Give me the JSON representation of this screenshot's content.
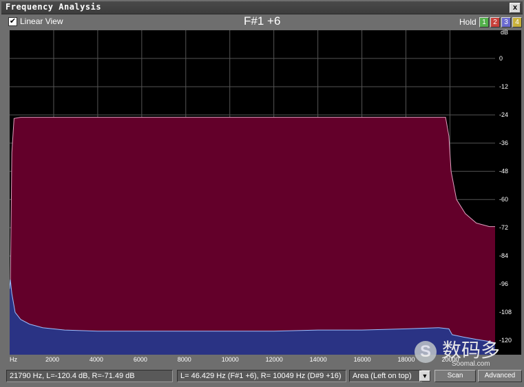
{
  "window": {
    "title": "Frequency Analysis",
    "close_glyph": "x"
  },
  "toolbar": {
    "linear_view_label": "Linear View",
    "linear_view_checked": true,
    "note_display": "F#1 +6",
    "hold_label": "Hold",
    "hold_buttons": [
      {
        "label": "1",
        "color": "#52b04a"
      },
      {
        "label": "2",
        "color": "#c8403a"
      },
      {
        "label": "3",
        "color": "#6a6ad0"
      },
      {
        "label": "4",
        "color": "#c8b03a"
      }
    ]
  },
  "chart_data": {
    "type": "area",
    "x_unit": "Hz",
    "y_unit": "dB",
    "xlim": [
      0,
      22050
    ],
    "ylim": [
      -126,
      12
    ],
    "x_ticks": [
      "Hz",
      "2000",
      "4000",
      "6000",
      "8000",
      "10000",
      "12000",
      "14000",
      "16000",
      "18000",
      "20000"
    ],
    "y_ticks": [
      "0",
      "-12",
      "-24",
      "-36",
      "-48",
      "-60",
      "-72",
      "-84",
      "-96",
      "-108",
      "-120"
    ],
    "grid": true,
    "series": [
      {
        "channel": "Right",
        "fill": "#63002a",
        "stroke": "#e0a0c0",
        "x": [
          0,
          100,
          200,
          500,
          1000,
          5000,
          10000,
          15000,
          19500,
          19800,
          19950,
          20050,
          20300,
          20700,
          21200,
          21790,
          22050
        ],
        "y": [
          -126,
          -40,
          -25.5,
          -25,
          -25,
          -25,
          -25,
          -25,
          -25,
          -25,
          -33,
          -48,
          -60,
          -66,
          -70,
          -71.5,
          -71.5
        ]
      },
      {
        "channel": "Left",
        "fill": "#2a3384",
        "stroke": "#9cc0ff",
        "x": [
          0,
          30,
          100,
          250,
          500,
          900,
          1500,
          2500,
          4000,
          6000,
          8000,
          10000,
          12000,
          14000,
          16000,
          18000,
          19500,
          19950,
          20100,
          20600,
          21200,
          21790,
          22050
        ],
        "y": [
          -98,
          -94,
          -100,
          -108,
          -111,
          -113,
          -114.5,
          -115.5,
          -116,
          -116,
          -116,
          -116,
          -116,
          -115.5,
          -115.5,
          -115,
          -114.5,
          -115,
          -117.5,
          -118.5,
          -119.5,
          -120.4,
          -121
        ]
      }
    ]
  },
  "status": {
    "cursor_readout": "21790 Hz, L=-120.4 dB, R=-71.49 dB",
    "peak_readout": "L= 46.429 Hz (F#1 +6), R=  10049 Hz (D#9 +16)",
    "view_mode": "Area (Left on top)",
    "dropdown_arrow_glyph": "▼",
    "scan_label": "Scan",
    "advanced_label": "Advanced"
  },
  "watermark": {
    "cn": "数码多",
    "en": "Soomal.com",
    "glyph": "S"
  }
}
